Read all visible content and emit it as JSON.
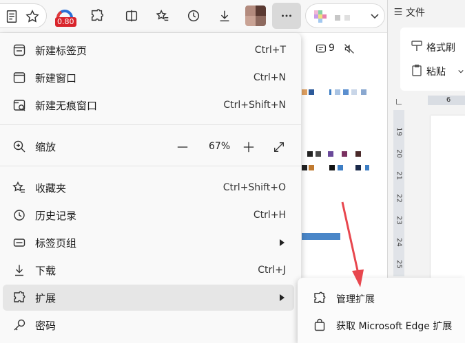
{
  "toolbar": {
    "extension_badge": "0.80"
  },
  "menu": {
    "items": [
      {
        "label": "新建标签页",
        "shortcut": "Ctrl+T"
      },
      {
        "label": "新建窗口",
        "shortcut": "Ctrl+N"
      },
      {
        "label": "新建无痕窗口",
        "shortcut": "Ctrl+Shift+N"
      },
      {
        "label": "缩放",
        "shortcut": ""
      },
      {
        "label": "收藏夹",
        "shortcut": "Ctrl+Shift+O"
      },
      {
        "label": "历史记录",
        "shortcut": "Ctrl+H"
      },
      {
        "label": "标签页组",
        "shortcut": ""
      },
      {
        "label": "下载",
        "shortcut": "Ctrl+J"
      },
      {
        "label": "扩展",
        "shortcut": ""
      },
      {
        "label": "密码",
        "shortcut": ""
      }
    ],
    "zoom": {
      "minus": "—",
      "value": "67%",
      "plus": "+"
    }
  },
  "submenu": {
    "items": [
      {
        "label": "管理扩展"
      },
      {
        "label": "获取 Microsoft Edge 扩展"
      }
    ]
  },
  "background_page": {
    "tab_count": "9"
  },
  "office": {
    "file_menu": "文件",
    "format_painter": "格式刷",
    "paste": "粘贴",
    "ruler_top": "6",
    "ruler_left": [
      "19",
      "20",
      "21",
      "22",
      "23",
      "24",
      "25"
    ]
  },
  "colors": {
    "menu_bg": "#f9f9f9",
    "hover_bg": "#e6e6e6",
    "annotation_arrow": "#e8474e",
    "badge": "#d9252c"
  }
}
